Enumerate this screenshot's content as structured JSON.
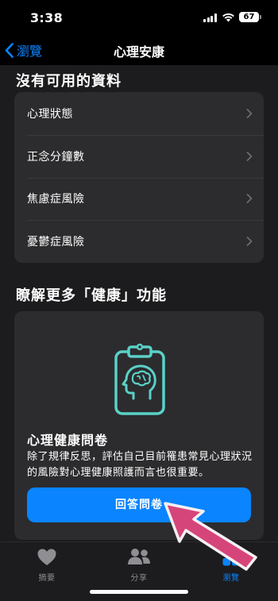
{
  "status": {
    "time": "3:38",
    "battery": "67"
  },
  "nav": {
    "back_label": "瀏覽",
    "title": "心理安康"
  },
  "no_data_section": {
    "title": "沒有可用的資料",
    "items": [
      {
        "label": "心理狀態"
      },
      {
        "label": "正念分鐘數"
      },
      {
        "label": "焦慮症風險"
      },
      {
        "label": "憂鬱症風險"
      }
    ]
  },
  "learn_more_section": {
    "title": "瞭解更多「健康」功能",
    "card_title": "心理健康問卷",
    "card_body": "除了規律反思，評估自己目前罹患常見心理狀況的風險對心理健康照護而言也很重要。",
    "button_label": "回答問卷",
    "icon": "clipboard-brain-icon"
  },
  "tab_bar": {
    "items": [
      {
        "label": "摘要",
        "icon": "heart-icon"
      },
      {
        "label": "分享",
        "icon": "people-icon"
      },
      {
        "label": "瀏覽",
        "icon": "grid-icon"
      }
    ],
    "active": "瀏覽"
  },
  "colors": {
    "accent": "#0a84ff",
    "card": "#2c2c2e",
    "background": "#1c1c1e",
    "illustration": "#5ad1c8",
    "pointer": "#d6457a"
  }
}
